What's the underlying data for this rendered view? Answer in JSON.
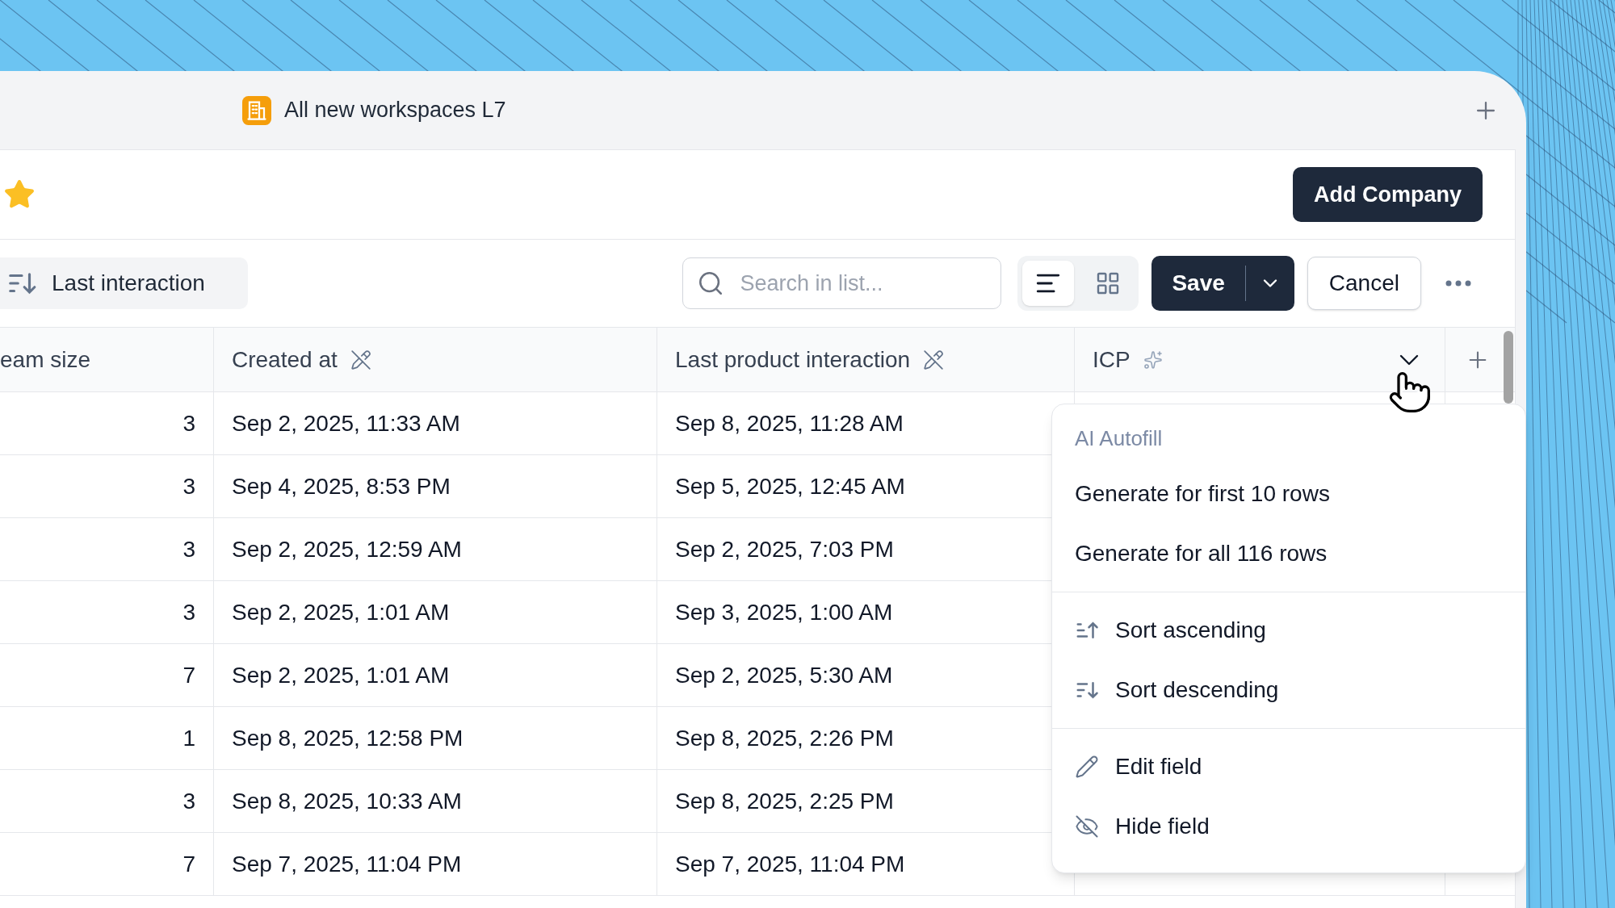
{
  "tab": {
    "title": "All new workspaces L7"
  },
  "header": {
    "starred": true,
    "primary_button": "Add Company"
  },
  "toolbar": {
    "sort_label": "Last interaction",
    "search": {
      "placeholder": "Search in list..."
    },
    "view_toggle": [
      {
        "kind": "list",
        "selected": true
      },
      {
        "kind": "grid",
        "selected": false
      }
    ],
    "save": "Save",
    "cancel": "Cancel"
  },
  "table": {
    "columns": [
      {
        "label": "eam size",
        "kind": "plain"
      },
      {
        "label": "Created at",
        "kind": "locked"
      },
      {
        "label": "Last product interaction",
        "kind": "locked"
      },
      {
        "label": "ICP",
        "kind": "ai"
      }
    ],
    "rows": [
      {
        "cells": [
          "3",
          "Sep 2, 2025, 11:33 AM",
          "Sep 8, 2025, 11:28 AM"
        ]
      },
      {
        "cells": [
          "3",
          "Sep 4, 2025, 8:53 PM",
          "Sep 5, 2025, 12:45 AM"
        ]
      },
      {
        "cells": [
          "3",
          "Sep 2, 2025, 12:59 AM",
          "Sep 2, 2025, 7:03 PM"
        ]
      },
      {
        "cells": [
          "3",
          "Sep 2, 2025, 1:01 AM",
          "Sep 3, 2025, 1:00 AM"
        ]
      },
      {
        "cells": [
          "7",
          "Sep 2, 2025, 1:01 AM",
          "Sep 2, 2025, 5:30 AM"
        ]
      },
      {
        "cells": [
          "1",
          "Sep 8, 2025, 12:58 PM",
          "Sep 8, 2025, 2:26 PM"
        ]
      },
      {
        "cells": [
          "3",
          "Sep 8, 2025, 10:33 AM",
          "Sep 8, 2025, 2:25 PM"
        ]
      },
      {
        "cells": [
          "7",
          "Sep 7, 2025, 11:04 PM",
          "Sep 7, 2025, 11:04 PM"
        ]
      }
    ]
  },
  "menu": {
    "groups": [
      {
        "heading": "AI Autofill",
        "items": [
          {
            "label": "Generate for first 10 rows",
            "kind": "text"
          },
          {
            "label": "Generate for all 116 rows",
            "kind": "text"
          }
        ]
      },
      {
        "items": [
          {
            "label": "Sort ascending",
            "kind": "sort_asc"
          },
          {
            "label": "Sort descending",
            "kind": "sort_desc"
          }
        ]
      },
      {
        "items": [
          {
            "label": "Edit field",
            "kind": "edit"
          },
          {
            "label": "Hide field",
            "kind": "hide"
          }
        ]
      }
    ]
  }
}
